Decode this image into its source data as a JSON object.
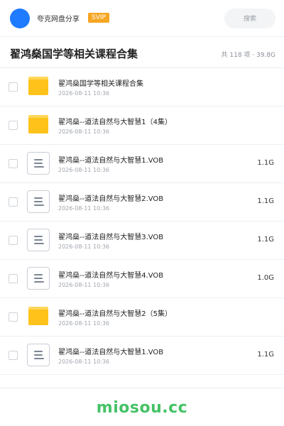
{
  "header": {
    "brand": "夸克网盘分享",
    "badge": "SVIP",
    "search_placeholder": "搜索"
  },
  "title": {
    "text": "翟鸿燊国学等相关课程合集",
    "summary": "共 118 项 · 39.8G"
  },
  "files": [
    {
      "type": "folder",
      "name": "翟鸿燊国学等相关课程合集",
      "date": "2026-08-11 10:36",
      "size": ""
    },
    {
      "type": "folder",
      "name": "翟鸿燊--道法自然与大智慧1（4集）",
      "date": "2026-08-11 10:36",
      "size": ""
    },
    {
      "type": "file",
      "name": "翟鸿燊--道法自然与大智慧1.VOB",
      "date": "2026-08-11 10:36",
      "size": "1.1G"
    },
    {
      "type": "file",
      "name": "翟鸿燊--道法自然与大智慧2.VOB",
      "date": "2026-08-11 10:36",
      "size": "1.1G"
    },
    {
      "type": "file",
      "name": "翟鸿燊--道法自然与大智慧3.VOB",
      "date": "2026-08-11 10:36",
      "size": "1.1G"
    },
    {
      "type": "file",
      "name": "翟鸿燊--道法自然与大智慧4.VOB",
      "date": "2026-08-11 10:36",
      "size": "1.0G"
    },
    {
      "type": "folder",
      "name": "翟鸿燊--道法自然与大智慧2（5集）",
      "date": "2026-08-11 10:36",
      "size": ""
    },
    {
      "type": "file",
      "name": "翟鸿燊--道法自然与大智慧1.VOB",
      "date": "2026-08-11 10:36",
      "size": "1.1G"
    }
  ],
  "icons": {
    "folder": "folder-icon",
    "file": "document-icon"
  },
  "colors": {
    "accent": "#1f7bff",
    "svip": "#f5a623",
    "folder": "#ffc21a",
    "watermark": "#45c266"
  },
  "watermark": "miosou.cc"
}
